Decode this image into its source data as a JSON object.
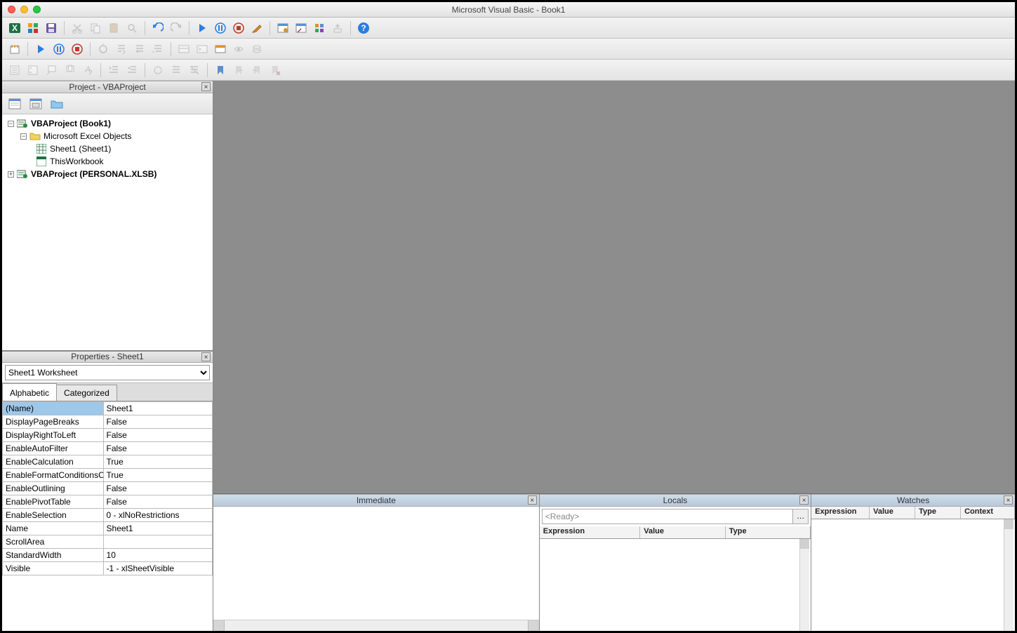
{
  "titlebar": {
    "title": "Microsoft Visual Basic - Book1"
  },
  "panels": {
    "project": {
      "title": "Project - VBAProject",
      "close": "×"
    },
    "properties": {
      "title": "Properties - Sheet1",
      "close": "×"
    },
    "immediate": {
      "title": "Immediate",
      "close": "×"
    },
    "locals": {
      "title": "Locals",
      "close": "×"
    },
    "watches": {
      "title": "Watches",
      "close": "×"
    }
  },
  "project_tree": {
    "root1": "VBAProject (Book1)",
    "folder1": "Microsoft Excel Objects",
    "item1": "Sheet1 (Sheet1)",
    "item2": "ThisWorkbook",
    "root2": "VBAProject (PERSONAL.XLSB)"
  },
  "properties": {
    "selector": "Sheet1 Worksheet",
    "tabs": {
      "alphabetic": "Alphabetic",
      "categorized": "Categorized"
    },
    "rows": [
      {
        "k": "(Name)",
        "v": "Sheet1"
      },
      {
        "k": "DisplayPageBreaks",
        "v": "False"
      },
      {
        "k": "DisplayRightToLeft",
        "v": "False"
      },
      {
        "k": "EnableAutoFilter",
        "v": "False"
      },
      {
        "k": "EnableCalculation",
        "v": "True"
      },
      {
        "k": "EnableFormatConditionsCalculation",
        "v": "True"
      },
      {
        "k": "EnableOutlining",
        "v": "False"
      },
      {
        "k": "EnablePivotTable",
        "v": "False"
      },
      {
        "k": "EnableSelection",
        "v": "0 - xlNoRestrictions"
      },
      {
        "k": "Name",
        "v": "Sheet1"
      },
      {
        "k": "ScrollArea",
        "v": ""
      },
      {
        "k": "StandardWidth",
        "v": "10"
      },
      {
        "k": "Visible",
        "v": "-1 - xlSheetVisible"
      }
    ]
  },
  "locals": {
    "ready": "<Ready>",
    "cols": {
      "expr": "Expression",
      "value": "Value",
      "type": "Type"
    }
  },
  "watches": {
    "cols": {
      "expr": "Expression",
      "value": "Value",
      "type": "Type",
      "context": "Context"
    }
  }
}
